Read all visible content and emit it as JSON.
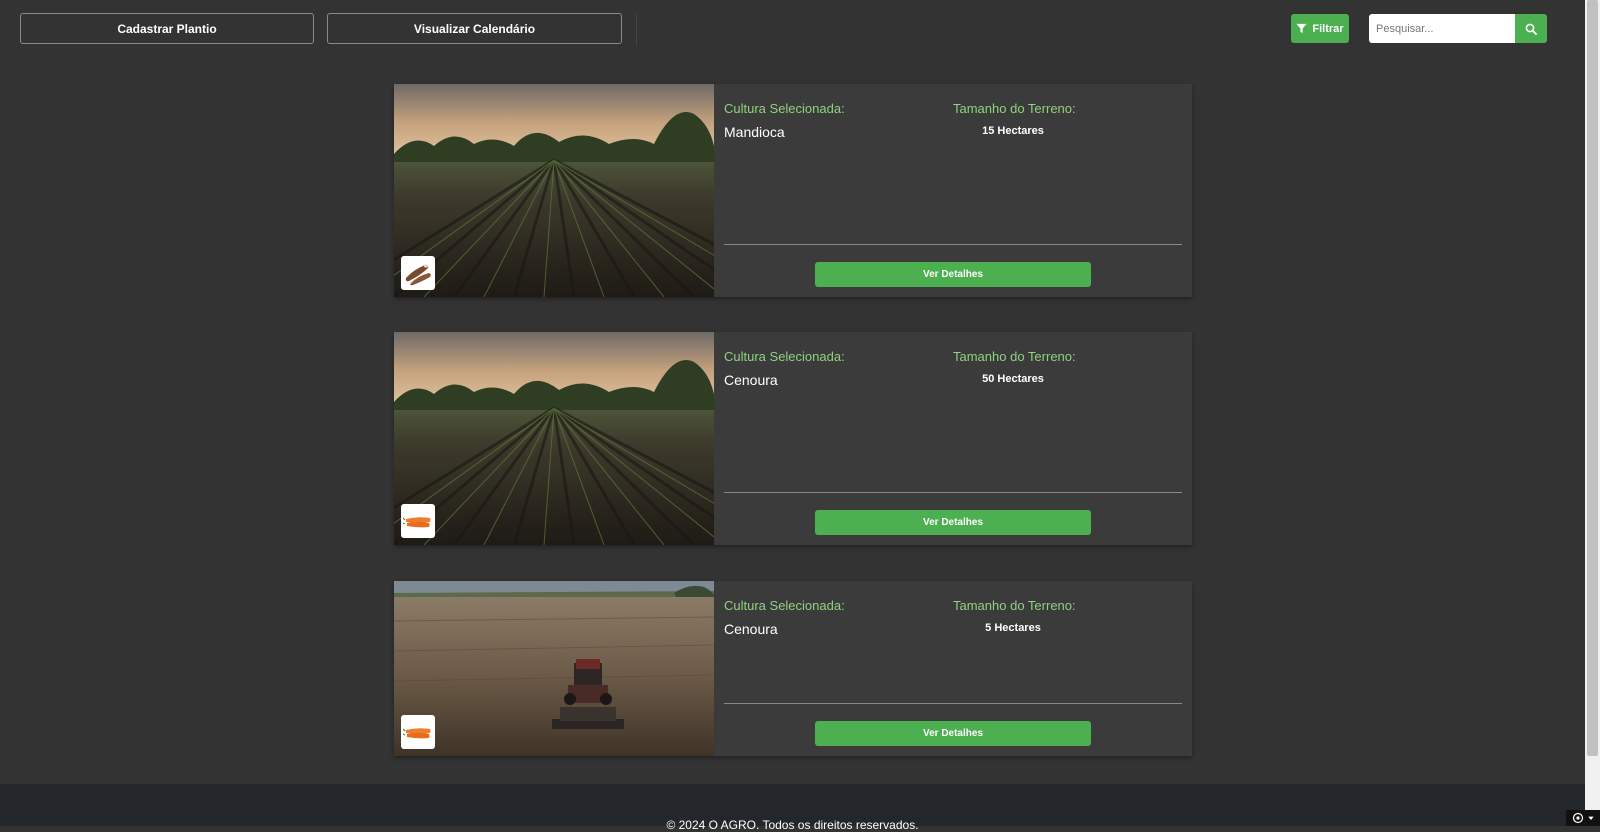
{
  "toolbar": {
    "register_label": "Cadastrar Plantio",
    "calendar_label": "Visualizar Calendário",
    "filter_label": "Filtrar",
    "search_placeholder": "Pesquisar..."
  },
  "colors": {
    "accent": "#4caf50",
    "label_green": "#8fd27f",
    "background": "#333333",
    "card": "#3b3b3b",
    "footer": "#23262a"
  },
  "cards": [
    {
      "crop_label": "Cultura Selecionada:",
      "crop": "Mandioca",
      "size_label": "Tamanho do Terreno:",
      "size": "15 Hectares",
      "button": "Ver Detalhes",
      "image": "crop-rows-sunset-field",
      "thumb_icon": "cassava-icon"
    },
    {
      "crop_label": "Cultura Selecionada:",
      "crop": "Cenoura",
      "size_label": "Tamanho do Terreno:",
      "size": "50 Hectares",
      "button": "Ver Detalhes",
      "image": "crop-rows-sunset-field",
      "thumb_icon": "carrot-icon"
    },
    {
      "crop_label": "Cultura Selecionada:",
      "crop": "Cenoura",
      "size_label": "Tamanho do Terreno:",
      "size": "5 Hectares",
      "button": "Ver Detalhes",
      "image": "tractor-plowed-field",
      "thumb_icon": "carrot-icon"
    }
  ],
  "footer": {
    "text": "© 2024 O AGRO. Todos os direitos reservados."
  }
}
